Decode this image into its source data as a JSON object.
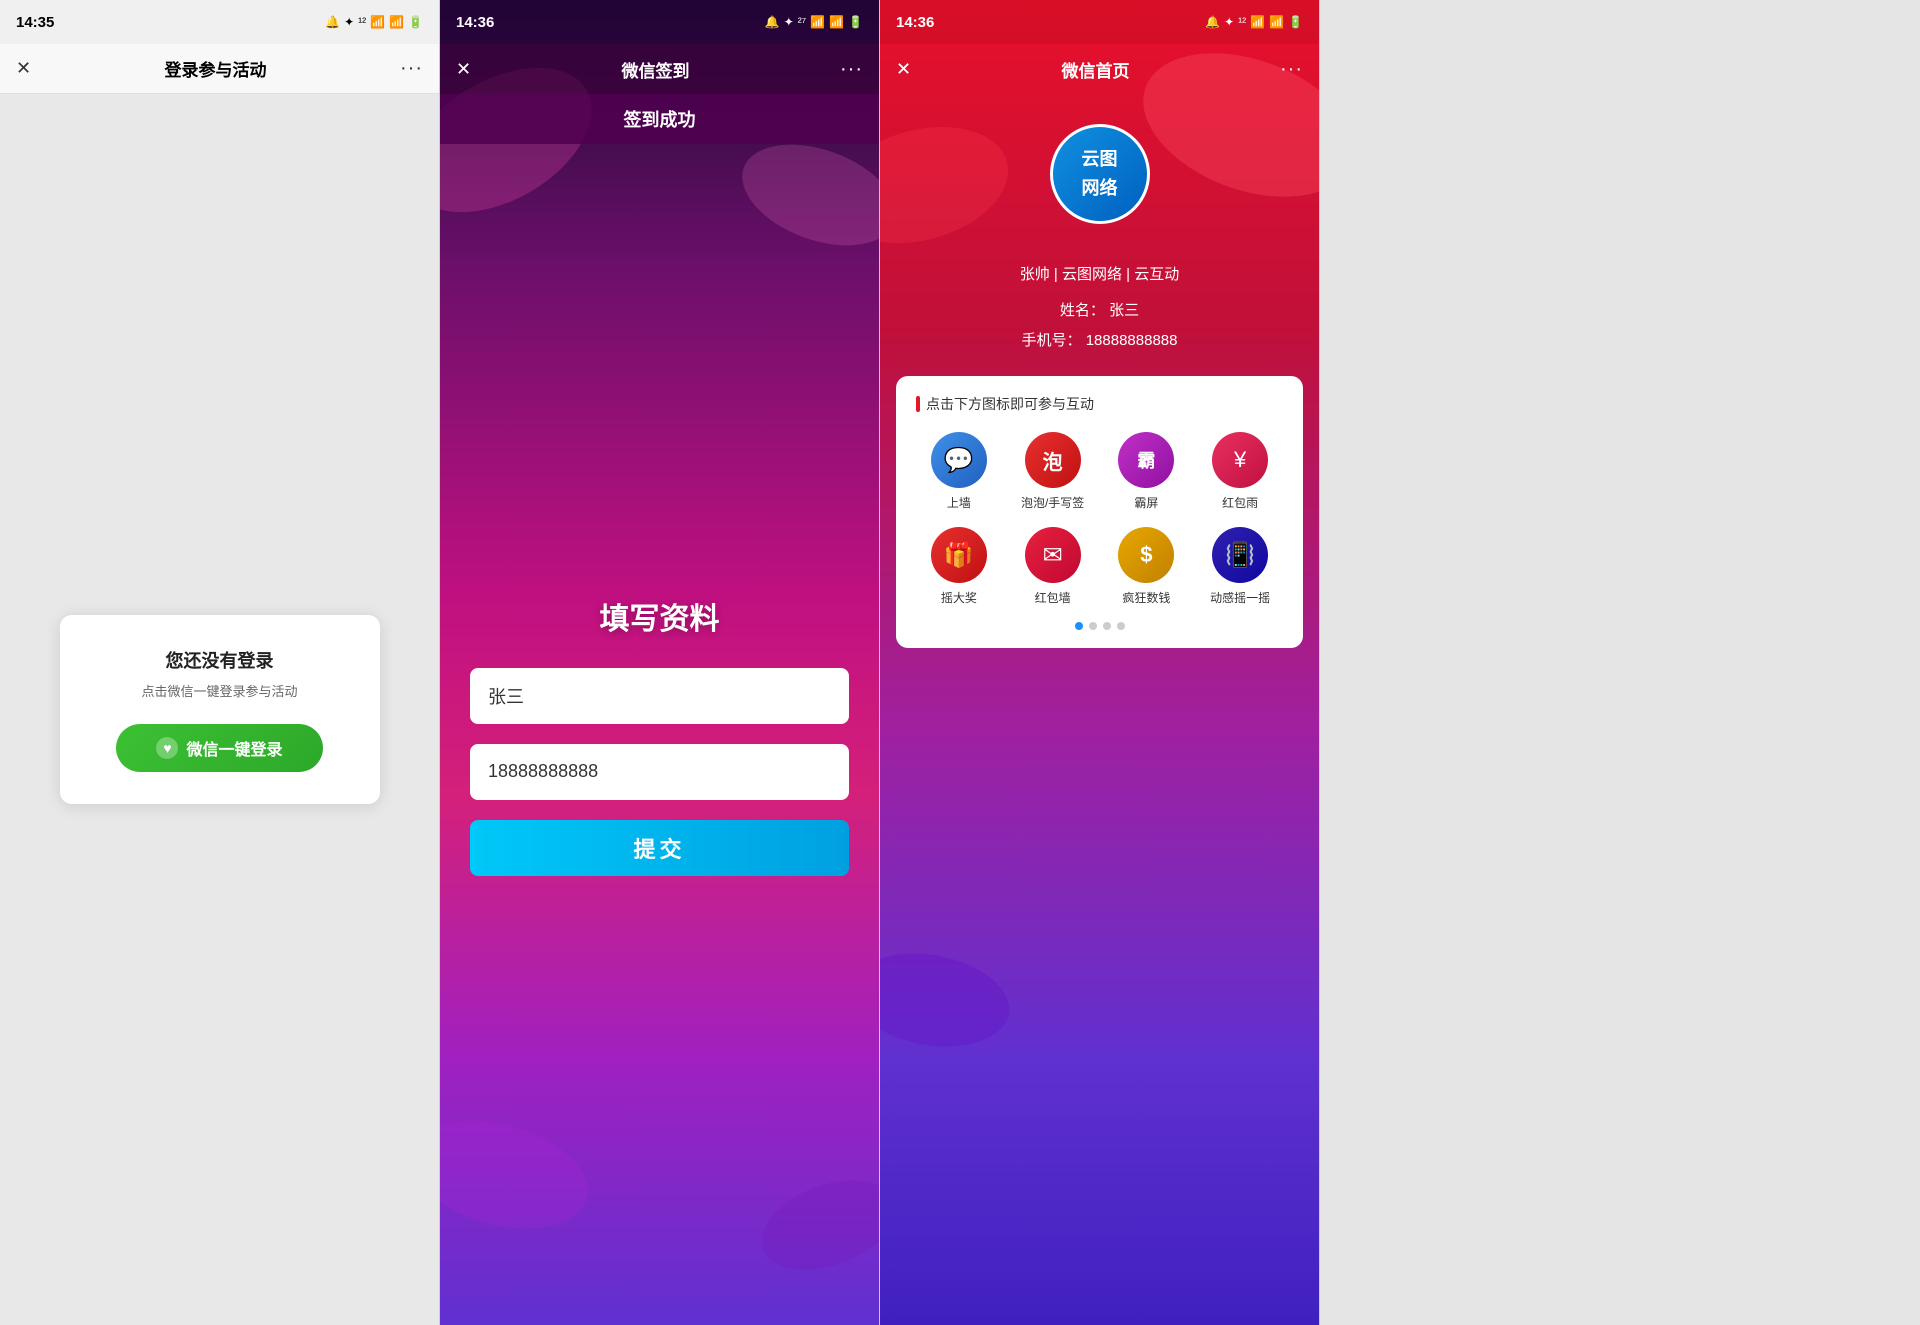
{
  "phone1": {
    "status": {
      "time": "14:35",
      "icons": "🔔 ✦ ¹²/ₛ 📶 📶 🔋"
    },
    "nav": {
      "close": "✕",
      "title": "登录参与活动",
      "menu": "···"
    },
    "card": {
      "title": "您还没有登录",
      "subtitle": "点击微信一键登录参与活动",
      "btn_label": "微信一键登录"
    }
  },
  "phone2": {
    "status": {
      "time": "14:36",
      "icons": "🔔 ✦ ²⁷/ₛ 📶 📶 🔋"
    },
    "nav": {
      "close": "✕",
      "title": "微信签到",
      "menu": "···"
    },
    "success_banner": "签到成功",
    "form": {
      "title": "填写资料",
      "name_placeholder": "张三",
      "phone_placeholder": "18888888888",
      "submit_label": "提交"
    }
  },
  "phone3": {
    "status": {
      "time": "14:36",
      "icons": "🔔 ✦ ¹²/ₛ 📶 📶 🔋"
    },
    "nav": {
      "close": "✕",
      "title": "微信首页",
      "menu": "···"
    },
    "logo_text_line1": "云图",
    "logo_text_line2": "网络",
    "user_title": "张帅 | 云图网络 | 云互动",
    "user_name_label": "姓名：",
    "user_name": "张三",
    "user_phone_label": "手机号：",
    "user_phone": "18888888888",
    "card": {
      "header": "点击下方图标即可参与互动",
      "icons": [
        {
          "label": "上墙",
          "color": "#3090e0",
          "char": "💬"
        },
        {
          "label": "泡泡/手写签",
          "color": "#e02020",
          "char": "泡"
        },
        {
          "label": "霸屏",
          "color": "#c020c0",
          "char": "霸"
        },
        {
          "label": "红包雨",
          "color": "#e02060",
          "char": "¥"
        },
        {
          "label": "摇大奖",
          "color": "#e03030",
          "char": "🎁"
        },
        {
          "label": "红包墙",
          "color": "#e02040",
          "char": "✉"
        },
        {
          "label": "疯狂数钱",
          "color": "#e0a000",
          "char": "$"
        },
        {
          "label": "动感摇一摇",
          "color": "#3020a0",
          "char": "📳"
        }
      ],
      "dots": [
        true,
        false,
        false,
        false
      ]
    }
  }
}
